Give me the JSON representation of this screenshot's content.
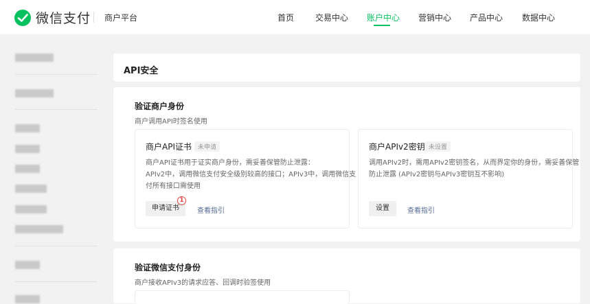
{
  "header": {
    "brand": "微信支付",
    "platform": "商户平台",
    "nav": [
      {
        "label": "首页",
        "active": false
      },
      {
        "label": "交易中心",
        "active": false
      },
      {
        "label": "账户中心",
        "active": true
      },
      {
        "label": "营销中心",
        "active": false
      },
      {
        "label": "产品中心",
        "active": false
      },
      {
        "label": "数据中心",
        "active": false
      }
    ]
  },
  "page": {
    "title": "API安全"
  },
  "section_merchant": {
    "title": "验证商户身份",
    "desc": "商户调用API时签名使用",
    "cert_card": {
      "title": "商户API证书",
      "badge": "未申请",
      "text1": "商户API证书用于证实商户身份，需妥善保管防止泄露：",
      "text2": "APIv2中，调用微信支付安全级别较高的接口；APIv3中，调用微信支",
      "text3": "付所有接口需使用",
      "button": "申请证书",
      "step": "1",
      "link": "查看指引"
    },
    "key_card": {
      "title": "商户APIv2密钥",
      "badge": "未设置",
      "text1": "调用APIv2时，需用APIv2密钥签名，从而界定你的身份，需妥善保管",
      "text2": "防止泄露 (APIv2密钥与APIv3密钥互不影响)",
      "button": "设置",
      "link": "查看指引"
    }
  },
  "section_wechat": {
    "title": "验证微信支付身份",
    "desc": "商户接收APIv3的请求应答、回调时验签使用"
  },
  "colors": {
    "brand_green": "#07c160",
    "link_blue": "#576b95",
    "step_red": "#e64340"
  }
}
